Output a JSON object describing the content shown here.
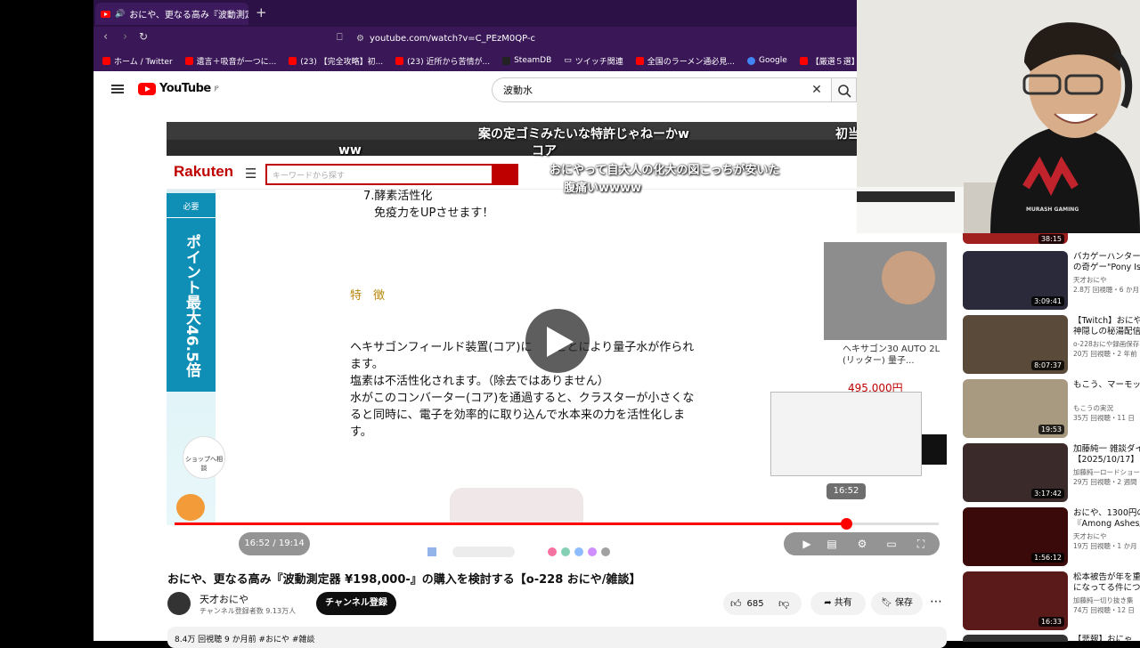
{
  "browser": {
    "tab_title": "おにや、更なる高み『波動測定器",
    "new_tab": "+",
    "url": "youtube.com/watch?v=C_PEzM0QP-c",
    "bookmarks": [
      "ホーム / Twitter",
      "遺言＋吸音が一つに...",
      "(23) 【完全攻略】初...",
      "(23) 近所から苦情が...",
      "SteamDB",
      "ツイッチ関連",
      "全国のラーメン通必見...",
      "Google",
      "【厳選５選】今キテる..."
    ]
  },
  "youtube": {
    "logo_text": "YouTube",
    "logo_sup": "JP",
    "search_value": "波動水"
  },
  "video": {
    "rakuten_logo": "Rakuten",
    "rakuten_placeholder": "キーワードから探す",
    "banner_top": "必要",
    "banner_main": "ポイント最大46.5倍",
    "shop_button": "ショップへ相談",
    "doc_line1": "7.酵素活性化",
    "doc_line2": "免疫力をUPさせます！",
    "doc_heading": "特　徴",
    "doc_body": [
      "ヘキサゴンフィールド装置(コア)に　　ことにより量子水が作られ",
      "ます。",
      "塩素は不活性化されます。（除去ではありません）",
      "水がこのコンバーター(コア)を通過すると、クラスターが小さくな",
      "ると同時に、電子を効率的に取り込んで水本来の力を活性化しま",
      "す。"
    ],
    "overlay_product": "ヘキサゴン30 AUTO 2L (リッター) 量子...",
    "overlay_price": "495,000円",
    "chat1": "案の定ゴミみたいな特許じゃねーかw",
    "chat2": "コア",
    "chat3": "ww",
    "chat4": "初当",
    "chat5": "おにやって自大人の化大の図こっちが安いた",
    "chat6": "腹痛いwwww",
    "hover_time": "16:52",
    "time_display": "16:52 / 19:14",
    "progress": 0.877
  },
  "meta": {
    "title": "おにや、更なる高み『波動測定器 ¥198,000-』の購入を検討する【o-228 おにや/雑談】",
    "channel": "天才おにや",
    "subs": "チャンネル登録者数 9.13万人",
    "subscribe": "チャンネル登録",
    "likes": "685",
    "share": "共有",
    "save": "保存",
    "more": "⋯",
    "desc": "8.4万 回視聴  9 か月前  #おにや #雑談"
  },
  "recs": [
    {
      "title": "バカゲーハンター",
      "title2": "の奇ゲー\"Pony Is",
      "channel": "天才おにや",
      "stats": "2.8万 回視聴・6 か月",
      "dur": "3:09:41",
      "color": "#2a2a3a"
    },
    {
      "title": "【Twitch】おにや",
      "title2": "神隠しの秘湯配信",
      "channel": "o-228おにや録画保存",
      "stats": "20万 回視聴・2 年前",
      "dur": "8:07:37",
      "color": "#5a4a3a"
    },
    {
      "title": "もこう、マーモッ",
      "title2": "",
      "channel": "もこうの実況",
      "stats": "35万 回視聴・11 日",
      "dur": "19:53",
      "color": "#a89a80"
    },
    {
      "title": "加藤純一 雑談ダイ",
      "title2": "【2025/10/17】",
      "channel": "加藤純一ロードショー",
      "stats": "29万 回視聴・2 週間",
      "dur": "3:17:42",
      "color": "#3a2a2a"
    },
    {
      "title": "おにや、1300円の",
      "title2": "『Among Ashes』",
      "channel": "天才おにや",
      "stats": "19万 回視聴・1 か月",
      "dur": "1:56:12",
      "color": "#3a0a0a"
    },
    {
      "title": "松本被告が年を重",
      "title2": "になってる件につ",
      "channel": "加藤純一切り抜き集",
      "stats": "74万 回視聴・12 日",
      "dur": "16:33",
      "color": "#5a1a1a"
    }
  ],
  "rec_top_dur": "38:15",
  "rec_bottom_title": "【悲報】おにゃ",
  "webcam": {
    "shirt_text": "MURASH GAMING"
  }
}
